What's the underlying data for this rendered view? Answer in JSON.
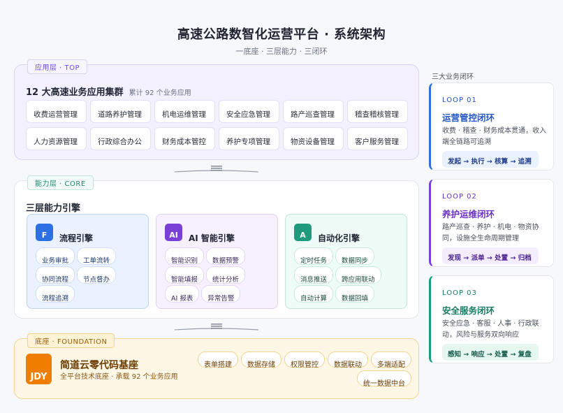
{
  "header": {
    "title": "高速公路数智化运营平台 · 系统架构",
    "subtitle": "一底座 · 三层能力 · 三闭环"
  },
  "app_layer": {
    "tag": "应用层 · TOP",
    "title": "12 大高速业务应用集群",
    "count": "累计 92 个业务应用",
    "apps": [
      "收费运营管理",
      "道路养护管理",
      "机电运维管理",
      "安全应急管理",
      "路产巡查管理",
      "稽查稽核管理",
      "人力资源管理",
      "行政综合办公",
      "财务成本管控",
      "养护专项管理",
      "物资设备管理",
      "客户服务管理"
    ]
  },
  "core_layer": {
    "tag": "能力层 · CORE",
    "title": "三层能力引擎",
    "engines": [
      {
        "icon": "F",
        "title": "流程引擎",
        "chips": [
          "业务审批",
          "工单流转",
          "协同流程",
          "节点督办",
          "流程追溯"
        ]
      },
      {
        "icon": "AI",
        "title": "AI 智能引擎",
        "chips": [
          "智能识别",
          "数据预警",
          "智能填报",
          "统计分析",
          "AI 报表",
          "异常告警"
        ]
      },
      {
        "icon": "A",
        "title": "自动化引擎",
        "chips": [
          "定时任务",
          "数据同步",
          "消息推送",
          "跨应用联动",
          "自动计算",
          "数据回填"
        ]
      }
    ]
  },
  "foundation": {
    "tag": "底座 · FOUNDATION",
    "logo": "JDY",
    "name": "简道云零代码基座",
    "desc": "全平台技术底座 · 承载 92 个业务应用",
    "chips": [
      "表单搭建",
      "数据存储",
      "权限管控",
      "数据联动",
      "多端适配",
      "统一数据中台"
    ]
  },
  "loops": {
    "title": "三大业务闭环",
    "items": [
      {
        "id": "LOOP 01",
        "name": "运营管控闭环",
        "desc": "收费 · 稽查 · 财务成本贯通，收入端全链路可追溯",
        "flow": "发起 → 执行 → 核算 → 追溯"
      },
      {
        "id": "LOOP 02",
        "name": "养护运维闭环",
        "desc": "路产巡查 · 养护 · 机电 · 物资协同，设施全生命周期管理",
        "flow": "发现 → 派单 → 处置 → 归档"
      },
      {
        "id": "LOOP 03",
        "name": "安全服务闭环",
        "desc": "安全应急 · 客服 · 人事 · 行政联动，风险与服务双向响应",
        "flow": "感知 → 响应 → 处置 → 复盘"
      }
    ]
  },
  "colors": {
    "app_accent": "#6d4ae0",
    "flow_engine": "#2f6fe4",
    "ai_engine": "#7a3fd6",
    "auto_engine": "#1f9a7c",
    "foundation": "#ef7d00"
  }
}
